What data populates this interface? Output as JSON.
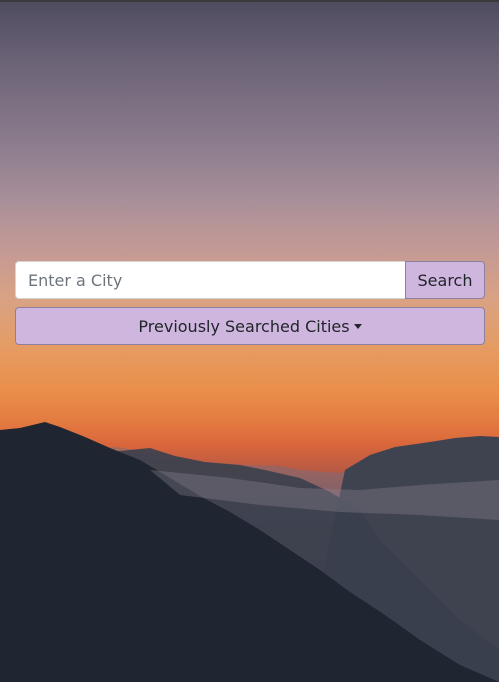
{
  "search": {
    "placeholder": "Enter a City",
    "value": "",
    "button_label": "Search"
  },
  "history": {
    "button_label": "Previously Searched Cities",
    "caret_icon": "caret-down-icon"
  },
  "background": {
    "image": "mountain-sunset",
    "button_color": "#cfb6df"
  }
}
